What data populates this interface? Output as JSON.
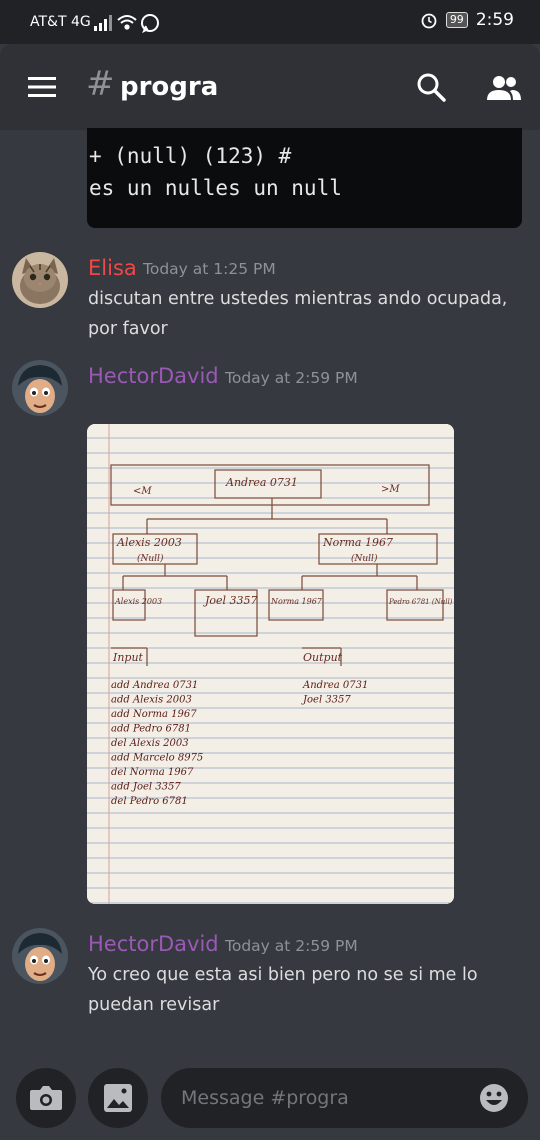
{
  "status_bar": {
    "carrier": "AT&T 4G",
    "battery": "99",
    "time": "2:59",
    "icons": [
      "signal-icon",
      "wifi-icon",
      "whatsapp-icon",
      "alarm-icon",
      "battery-icon"
    ]
  },
  "channel": {
    "hash": "#",
    "name": "progra"
  },
  "code_block": {
    "line1": "+ (null) (123) #",
    "line2": "es un nulles un null"
  },
  "messages": [
    {
      "author": "Elisa",
      "author_color": "#f04747",
      "timestamp": "Today at 1:25 PM",
      "text": "discutan entre ustedes mientras ando ocupada, por favor"
    },
    {
      "author": "HectorDavid",
      "author_color": "#9b59b6",
      "timestamp": "Today at 2:59 PM",
      "attachment": {
        "tree": {
          "left_label": "<M",
          "right_label": ">M",
          "root": "Andrea 0731",
          "level1": [
            "Alexis 2003",
            "(Null)",
            "Norma 1967",
            "(Null)"
          ],
          "level2": [
            "Alexis 2003",
            "Joel 3357",
            "Norma 1967",
            "Pedro 6781 (Null)"
          ]
        },
        "input_header": "Input",
        "input_lines": [
          "add Andrea 0731",
          "add Alexis 2003",
          "add Norma 1967",
          "add Pedro 6781",
          "del Alexis 2003",
          "add Marcelo 8975",
          "del Norma 1967",
          "add Joel 3357",
          "del Pedro 6781"
        ],
        "output_header": "Output",
        "output_lines": [
          "Andrea 0731",
          "Joel 3357"
        ]
      }
    },
    {
      "author": "HectorDavid",
      "author_color": "#9b59b6",
      "timestamp": "Today at 2:59 PM",
      "text": "Yo creo que esta asi bien pero no se si me lo puedan revisar"
    }
  ],
  "composer": {
    "placeholder": "Message #progra",
    "icons": [
      "camera-icon",
      "image-icon",
      "emoji-icon"
    ]
  },
  "colors": {
    "background": "#36393f",
    "appbar": "#2f3136",
    "input": "#202225"
  }
}
